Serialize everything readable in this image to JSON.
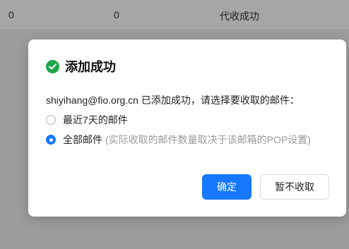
{
  "background_row": {
    "col1": "0",
    "col2": "0",
    "col3": "代收成功"
  },
  "dialog": {
    "icon": "check-circle-icon",
    "title": "添加成功",
    "message": "shiyihang@fio.org.cn 已添加成功，请选择要收取的邮件：",
    "options": [
      {
        "label": "最近7天的邮件",
        "hint": "",
        "selected": false
      },
      {
        "label": "全部邮件",
        "hint": "(实际收取的邮件数量取决于该邮箱的POP设置)",
        "selected": true
      }
    ],
    "confirm_label": "确定",
    "cancel_label": "暂不收取"
  },
  "colors": {
    "accent": "#1677ff",
    "success": "#1fa64a",
    "hint": "#9a9a9a"
  }
}
